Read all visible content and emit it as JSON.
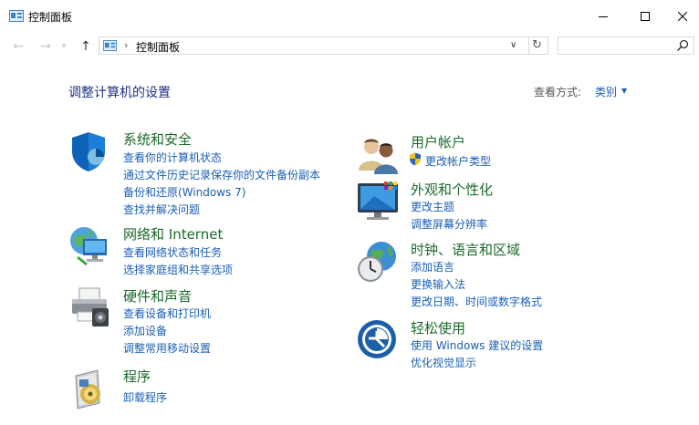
{
  "window": {
    "title": "控制面板"
  },
  "address": {
    "path": "控制面板"
  },
  "search": {
    "placeholder": ""
  },
  "header": {
    "title": "调整计算机的设置",
    "view_by_label": "查看方式:",
    "view_by_value": "类别"
  },
  "categories": [
    {
      "title": "系统和安全",
      "icon": "shield-icon",
      "links": [
        "查看你的计算机状态",
        "通过文件历史记录保存你的文件备份副本",
        "备份和还原(Windows 7)",
        "查找并解决问题"
      ]
    },
    {
      "title": "网络和 Internet",
      "icon": "network-globe-icon",
      "links": [
        "查看网络状态和任务",
        "选择家庭组和共享选项"
      ]
    },
    {
      "title": "硬件和声音",
      "icon": "printer-icon",
      "links": [
        "查看设备和打印机",
        "添加设备",
        "调整常用移动设置"
      ]
    },
    {
      "title": "程序",
      "icon": "programs-icon",
      "links": [
        "卸载程序"
      ]
    },
    {
      "title": "用户帐户",
      "icon": "users-icon",
      "links": [
        "更改帐户类型"
      ]
    },
    {
      "title": "外观和个性化",
      "icon": "monitor-icon",
      "links": [
        "更改主题",
        "调整屏幕分辨率"
      ]
    },
    {
      "title": "时钟、语言和区域",
      "icon": "clock-globe-icon",
      "links": [
        "添加语言",
        "更换输入法",
        "更改日期、时间或数字格式"
      ]
    },
    {
      "title": "轻松使用",
      "icon": "ease-of-access-icon",
      "links": [
        "使用 Windows 建议的设置",
        "优化视觉显示"
      ]
    }
  ],
  "colors": {
    "category_title": "#1a6a2a",
    "link": "#1a5fb4",
    "heading": "#1e3287"
  }
}
